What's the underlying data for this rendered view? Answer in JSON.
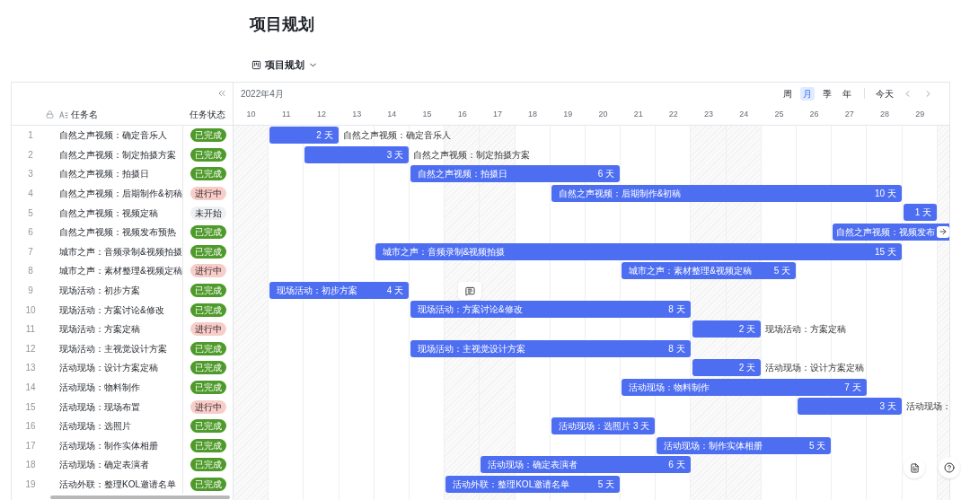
{
  "page_title": "项目规划",
  "view_selector": {
    "label": "项目规划"
  },
  "table": {
    "columns": [
      "任务名",
      "任务状态"
    ],
    "rows": [
      {
        "index": "1",
        "name": "自然之声视频：确定音乐人",
        "status": "已完成",
        "kind": "done"
      },
      {
        "index": "2",
        "name": "自然之声视频：制定拍摄方案",
        "status": "已完成",
        "kind": "done"
      },
      {
        "index": "3",
        "name": "自然之声视频：拍摄日",
        "status": "已完成",
        "kind": "done"
      },
      {
        "index": "4",
        "name": "自然之声视频：后期制作&初稿",
        "status": "进行中",
        "kind": "in_progress"
      },
      {
        "index": "5",
        "name": "自然之声视频：视频定稿",
        "status": "未开始",
        "kind": "not_started"
      },
      {
        "index": "6",
        "name": "自然之声视频：视频发布预热",
        "status": "已完成",
        "kind": "done"
      },
      {
        "index": "7",
        "name": "城市之声：音频录制&视频拍摄",
        "status": "已完成",
        "kind": "done"
      },
      {
        "index": "8",
        "name": "城市之声：素材整理&视频定稿",
        "status": "进行中",
        "kind": "in_progress"
      },
      {
        "index": "9",
        "name": "现场活动：初步方案",
        "status": "已完成",
        "kind": "done"
      },
      {
        "index": "10",
        "name": "现场活动：方案讨论&修改",
        "status": "已完成",
        "kind": "done"
      },
      {
        "index": "11",
        "name": "现场活动：方案定稿",
        "status": "进行中",
        "kind": "in_progress"
      },
      {
        "index": "12",
        "name": "现场活动：主视觉设计方案",
        "status": "已完成",
        "kind": "done"
      },
      {
        "index": "13",
        "name": "活动现场：设计方案定稿",
        "status": "已完成",
        "kind": "done"
      },
      {
        "index": "14",
        "name": "活动现场：物料制作",
        "status": "已完成",
        "kind": "done"
      },
      {
        "index": "15",
        "name": "活动现场：现场布置",
        "status": "进行中",
        "kind": "in_progress"
      },
      {
        "index": "16",
        "name": "活动现场：选照片",
        "status": "已完成",
        "kind": "done"
      },
      {
        "index": "17",
        "name": "活动现场：制作实体相册",
        "status": "已完成",
        "kind": "done"
      },
      {
        "index": "18",
        "name": "活动现场：确定表演者",
        "status": "已完成",
        "kind": "done"
      },
      {
        "index": "19",
        "name": "活动外联：整理KOL邀请名单",
        "status": "已完成",
        "kind": "done"
      }
    ]
  },
  "gantt": {
    "month": "2022年4月",
    "scales": [
      {
        "label": "周",
        "selected": false
      },
      {
        "label": "月",
        "selected": true
      },
      {
        "label": "季",
        "selected": false
      },
      {
        "label": "年",
        "selected": false
      }
    ],
    "today_button": "今天",
    "days": [
      {
        "label": "10",
        "weekend": true
      },
      {
        "label": "11",
        "weekend": false
      },
      {
        "label": "12",
        "weekend": false
      },
      {
        "label": "13",
        "weekend": false
      },
      {
        "label": "14",
        "weekend": false
      },
      {
        "label": "15",
        "weekend": false
      },
      {
        "label": "16",
        "weekend": true
      },
      {
        "label": "17",
        "weekend": true
      },
      {
        "label": "18",
        "weekend": false
      },
      {
        "label": "19",
        "weekend": false
      },
      {
        "label": "20",
        "weekend": false
      },
      {
        "label": "21",
        "weekend": false
      },
      {
        "label": "22",
        "weekend": false
      },
      {
        "label": "23",
        "weekend": true
      },
      {
        "label": "24",
        "weekend": true
      },
      {
        "label": "25",
        "weekend": false
      },
      {
        "label": "26",
        "weekend": false
      },
      {
        "label": "27",
        "weekend": false
      },
      {
        "label": "28",
        "weekend": false
      },
      {
        "label": "29",
        "weekend": false
      }
    ],
    "bars": [
      {
        "duration": "2 天",
        "label": "自然之声视频：确定音乐人",
        "kind": "outside"
      },
      {
        "duration": "3 天",
        "label": "自然之声视频：制定拍摄方案",
        "kind": "outside"
      },
      {
        "duration": "6 天",
        "label": "自然之声视频：拍摄日",
        "kind": "inside"
      },
      {
        "duration": "10 天",
        "label": "自然之声视频：后期制作&初稿",
        "kind": "inside"
      },
      {
        "duration": "1 天",
        "kind": "outside"
      },
      {
        "label": "自然之声视频：视频发布",
        "kind": "cut"
      },
      {
        "duration": "15 天",
        "label": "城市之声：音频录制&视频拍摄",
        "kind": "inside"
      },
      {
        "duration": "5 天",
        "label": "城市之声：素材整理&视频定稿",
        "kind": "inside"
      },
      {
        "duration": "4 天",
        "label": "现场活动：初步方案",
        "kind": "inside"
      },
      {
        "duration": "8 天",
        "label": "现场活动：方案讨论&修改",
        "kind": "inside"
      },
      {
        "duration": "2 天",
        "label": "现场活动：方案定稿",
        "kind": "outside"
      },
      {
        "duration": "8 天",
        "label": "现场活动：主视觉设计方案",
        "kind": "inside"
      },
      {
        "duration": "2 天",
        "label": "活动现场：设计方案定稿",
        "kind": "outside"
      },
      {
        "duration": "7 天",
        "label": "活动现场：物料制作",
        "kind": "inside"
      },
      {
        "duration": "3 天",
        "label": "活动现场：",
        "kind": "outside"
      },
      {
        "duration": "3 天",
        "label": "活动现场：选照片",
        "kind": "inside"
      },
      {
        "duration": "5 天",
        "label": "活动现场：制作实体相册",
        "kind": "inside"
      },
      {
        "duration": "6 天",
        "label": "活动现场：确定表演者",
        "kind": "inside"
      },
      {
        "duration": "5 天",
        "label": "活动外联：整理KOL邀请名单",
        "kind": "inside"
      }
    ]
  }
}
